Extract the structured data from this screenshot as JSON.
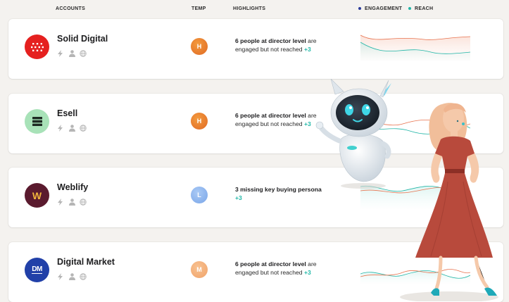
{
  "header": {
    "accounts": "ACCOUNTS",
    "temp": "TEMP",
    "highlights": "HIGHLIGHTS",
    "legend": [
      {
        "label": "ENGAGEMENT",
        "color": "#2a3a9a"
      },
      {
        "label": "REACH",
        "color": "#20b5a6"
      }
    ]
  },
  "accounts": [
    {
      "name": "Solid Digital",
      "logo": "solid-digital-logo",
      "temp": "H",
      "highlight": {
        "bold": "6 people at director level",
        "rest": " are engaged but not reached ",
        "plus": "+3"
      }
    },
    {
      "name": "Esell",
      "logo": "esell-logo",
      "temp": "H",
      "highlight": {
        "bold": "6 people at director level",
        "rest": " are engaged but not reached ",
        "plus": "+3"
      }
    },
    {
      "name": "Weblify",
      "logo": "weblify-logo",
      "logo_text": "W",
      "temp": "L",
      "highlight": {
        "bold": "3 missing key buying persona",
        "rest": " ",
        "plus": "+3"
      }
    },
    {
      "name": "Digital Market",
      "logo": "digital-market-logo",
      "logo_text": "DM",
      "temp": "M",
      "highlight": {
        "bold": "6 people at director level",
        "rest": " are engaged but not reached ",
        "plus": "+3"
      }
    }
  ],
  "colors": {
    "reach": "#20b5a6",
    "engagement": "#e8734f",
    "temp_high": "#e8792e",
    "temp_low": "#8cb4ee",
    "temp_medium": "#f3ad76"
  }
}
